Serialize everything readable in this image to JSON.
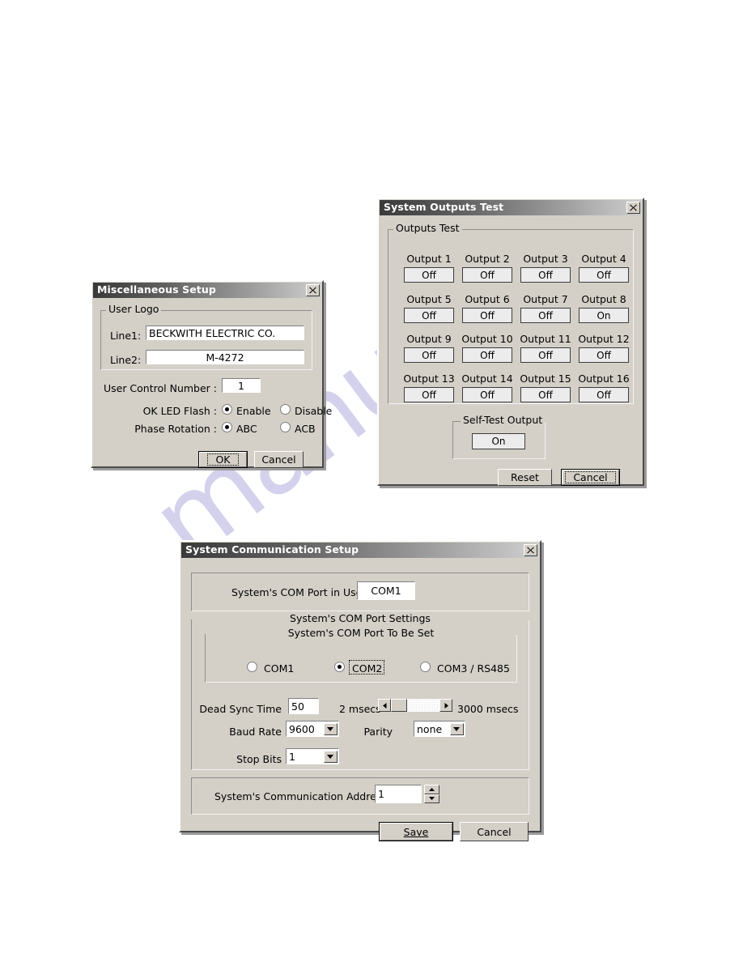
{
  "page": {
    "background_color": "#ffffff",
    "watermark_text": "manualshive.com",
    "watermark_color": "#b9b6e2"
  },
  "misc_setup": {
    "title": "Miscellaneous Setup",
    "close_icon": "close-x-icon",
    "user_logo_group": "User Logo",
    "line1_label": "Line1:",
    "line1_value": "BECKWITH ELECTRIC CO.",
    "line2_label": "Line2:",
    "line2_value": "M-4272",
    "user_control_number_label": "User Control Number :",
    "user_control_number_value": "1",
    "ok_led_flash_label": "OK LED Flash :",
    "ok_led_enable": "Enable",
    "ok_led_disable": "Disable",
    "ok_led_selected": "Enable",
    "phase_rotation_label": "Phase Rotation :",
    "phase_abc": "ABC",
    "phase_acb": "ACB",
    "phase_selected": "ABC",
    "ok_button": "OK",
    "cancel_button": "Cancel"
  },
  "outputs_test": {
    "title": "System Outputs Test",
    "close_icon": "close-x-icon",
    "group_label": "Outputs Test",
    "outputs": [
      {
        "label": "Output 1",
        "state": "Off"
      },
      {
        "label": "Output 2",
        "state": "Off"
      },
      {
        "label": "Output 3",
        "state": "Off"
      },
      {
        "label": "Output 4",
        "state": "Off"
      },
      {
        "label": "Output 5",
        "state": "Off"
      },
      {
        "label": "Output 6",
        "state": "Off"
      },
      {
        "label": "Output 7",
        "state": "Off"
      },
      {
        "label": "Output 8",
        "state": "On"
      },
      {
        "label": "Output 9",
        "state": "Off"
      },
      {
        "label": "Output 10",
        "state": "Off"
      },
      {
        "label": "Output 11",
        "state": "Off"
      },
      {
        "label": "Output 12",
        "state": "Off"
      },
      {
        "label": "Output 13",
        "state": "Off"
      },
      {
        "label": "Output 14",
        "state": "Off"
      },
      {
        "label": "Output 15",
        "state": "Off"
      },
      {
        "label": "Output 16",
        "state": "Off"
      }
    ],
    "self_test_group": "Self-Test Output",
    "self_test_state": "On",
    "reset_button": "Reset",
    "cancel_button": "Cancel"
  },
  "comm_setup": {
    "title": "System Communication Setup",
    "close_icon": "close-x-icon",
    "port_in_use_label": "System's COM Port in Use",
    "port_in_use_value": "COM1",
    "settings_group": "System's COM Port Settings",
    "port_to_set_group": "System's COM Port To Be Set",
    "port_options": [
      "COM1",
      "COM2",
      "COM3 / RS485"
    ],
    "port_selected": "COM2",
    "dead_sync_label": "Dead Sync Time",
    "dead_sync_value": "50",
    "dead_sync_min": "2 msecs",
    "dead_sync_max": "3000 msecs",
    "baud_rate_label": "Baud Rate",
    "baud_rate_value": "9600",
    "parity_label": "Parity",
    "parity_value": "none",
    "stop_bits_label": "Stop Bits",
    "stop_bits_value": "1",
    "address_label": "System's Communication Address",
    "address_value": "1",
    "save_button": "Save",
    "cancel_button": "Cancel"
  }
}
